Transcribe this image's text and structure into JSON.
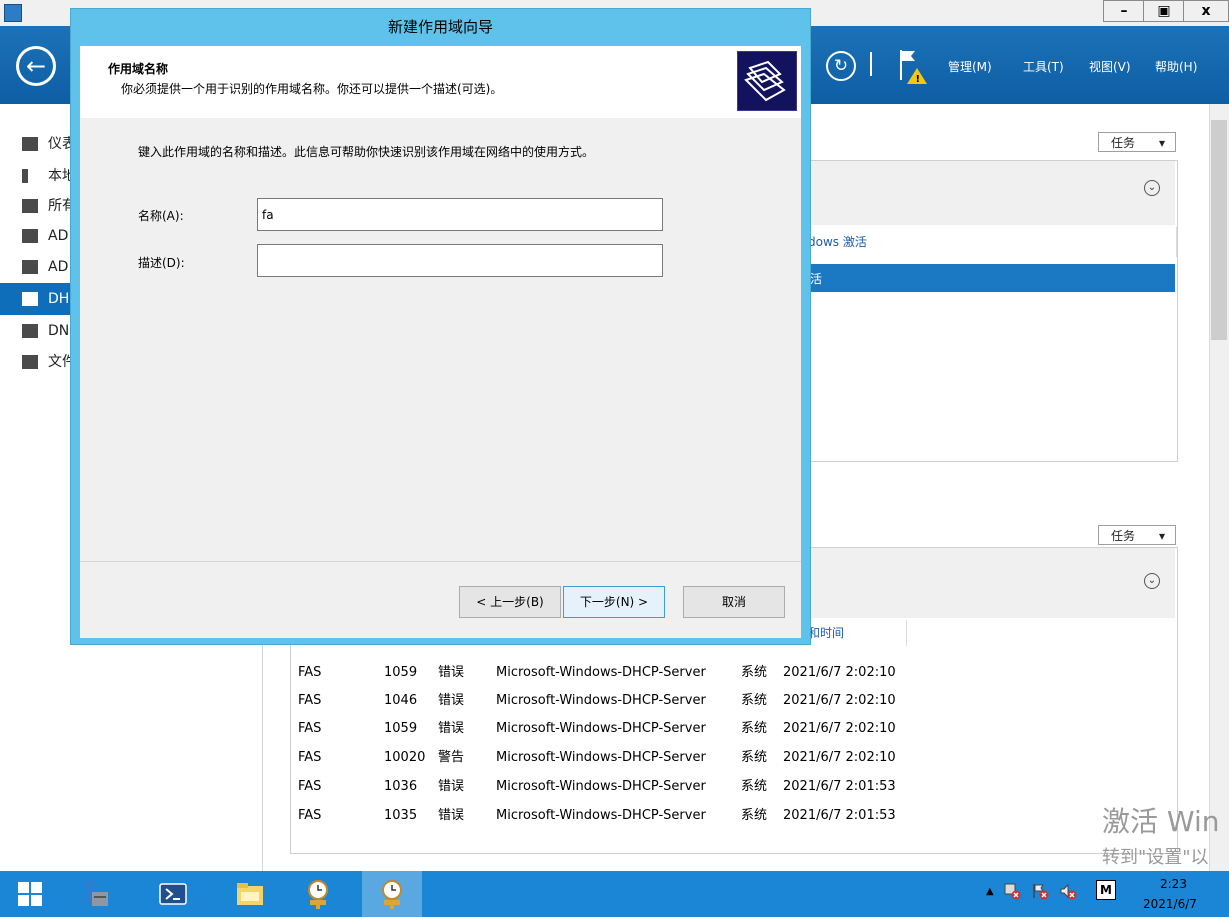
{
  "server_manager": {
    "menus": [
      "管理(M)",
      "工具(T)",
      "视图(V)",
      "帮助(H)"
    ],
    "sidebar": [
      {
        "label": "仪表",
        "icon": "dashboard-icon"
      },
      {
        "label": "本地",
        "icon": "local-server-icon"
      },
      {
        "label": "所有",
        "icon": "all-servers-icon"
      },
      {
        "label": "AD",
        "icon": "ad-cs-icon"
      },
      {
        "label": "AD",
        "icon": "ad-ds-icon"
      },
      {
        "label": "DH",
        "icon": "dhcp-icon",
        "selected": true
      },
      {
        "label": "DN",
        "icon": "dns-icon"
      },
      {
        "label": "文件",
        "icon": "file-services-icon"
      }
    ],
    "tasks_label": "任务",
    "panel1": {
      "column_text": "dows 激活",
      "selected_row_text": "活"
    },
    "panel2": {
      "column_text": "和时间"
    },
    "events": [
      {
        "server": "FAS",
        "id": "1059",
        "severity": "错误",
        "source": "Microsoft-Windows-DHCP-Server",
        "log": "系统",
        "time": "2021/6/7 2:02:10"
      },
      {
        "server": "FAS",
        "id": "1046",
        "severity": "错误",
        "source": "Microsoft-Windows-DHCP-Server",
        "log": "系统",
        "time": "2021/6/7 2:02:10"
      },
      {
        "server": "FAS",
        "id": "1059",
        "severity": "错误",
        "source": "Microsoft-Windows-DHCP-Server",
        "log": "系统",
        "time": "2021/6/7 2:02:10"
      },
      {
        "server": "FAS",
        "id": "10020",
        "severity": "警告",
        "source": "Microsoft-Windows-DHCP-Server",
        "log": "系统",
        "time": "2021/6/7 2:02:10"
      },
      {
        "server": "FAS",
        "id": "1036",
        "severity": "错误",
        "source": "Microsoft-Windows-DHCP-Server",
        "log": "系统",
        "time": "2021/6/7 2:01:53"
      },
      {
        "server": "FAS",
        "id": "1035",
        "severity": "错误",
        "source": "Microsoft-Windows-DHCP-Server",
        "log": "系统",
        "time": "2021/6/7 2:01:53"
      }
    ],
    "watermark_line1": "激活 Win",
    "watermark_line2": "转到\"设置\"以"
  },
  "dialog": {
    "title": "新建作用域向导",
    "header_title": "作用域名称",
    "header_subtitle": "你必须提供一个用于识别的作用域名称。你还可以提供一个描述(可选)。",
    "instruction": "键入此作用域的名称和描述。此信息可帮助你快速识别该作用域在网络中的使用方式。",
    "name_label": "名称(A):",
    "name_value": "fa",
    "desc_label": "描述(D):",
    "desc_value": "",
    "back_label": "< 上一步(B)",
    "next_label": "下一步(N) >",
    "cancel_label": "取消"
  },
  "taskbar": {
    "time": "2:23",
    "date": "2021/6/7",
    "tray_input_indicator": "M"
  }
}
